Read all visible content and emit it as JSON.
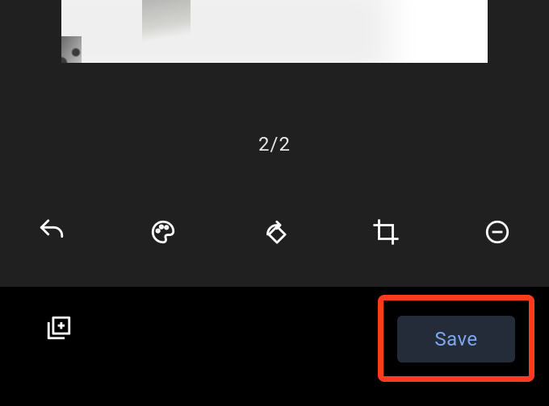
{
  "counter": "2/2",
  "toolbar": {
    "icons": {
      "undo": "undo-icon",
      "palette": "palette-icon",
      "rotate": "rotate-icon",
      "crop": "crop-icon",
      "remove": "remove-icon"
    }
  },
  "bottom": {
    "add_icon": "add-page-icon",
    "save_label": "Save"
  }
}
